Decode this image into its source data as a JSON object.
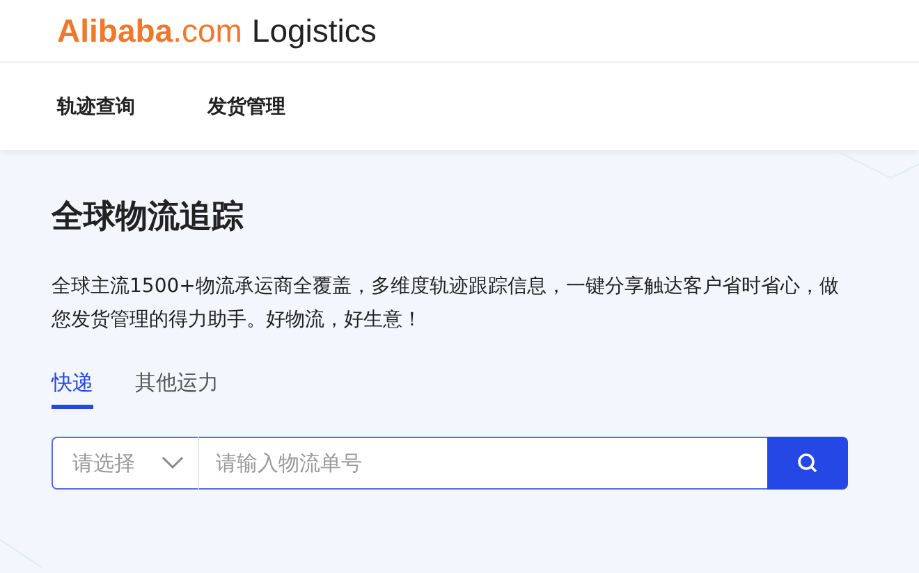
{
  "header": {
    "logo": "**Alibaba**.com",
    "product": "Logistics"
  },
  "nav": [
    {
      "label": "轨迹查询"
    },
    {
      "label": "发货管理"
    }
  ],
  "title": "全球物流追踪",
  "description": "全球主流1500+物流承运商全覆盖，多维度轨迹跟踪信息，一键分享触达客户省时省心，做您发货管理的得力助手。好物流，好生意！",
  "tabs": [
    {
      "label": "快递",
      "selected": true
    },
    {
      "label": "其他运力",
      "selected": false
    }
  ],
  "search": {
    "select_placeholder": "请选择",
    "placeholder": "请输入物流单号"
  }
}
